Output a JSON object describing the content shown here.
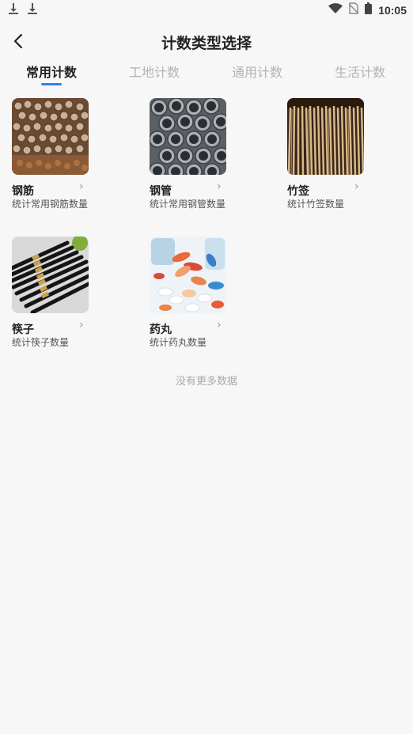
{
  "status_bar": {
    "time": "10:05",
    "left_icons": [
      "download-icon",
      "download-icon"
    ],
    "right_icons": [
      "wifi-icon",
      "no-sim-icon",
      "battery-icon"
    ]
  },
  "header": {
    "title": "计数类型选择",
    "back_icon": "chevron-left-icon"
  },
  "tabs": [
    {
      "label": "常用计数",
      "active": true
    },
    {
      "label": "工地计数",
      "active": false
    },
    {
      "label": "通用计数",
      "active": false
    },
    {
      "label": "生活计数",
      "active": false
    }
  ],
  "colors": {
    "accent": "#2f80ed"
  },
  "cards": [
    {
      "title": "钢筋",
      "desc": "统计常用钢筋数量",
      "image": "rebar-bundle"
    },
    {
      "title": "钢管",
      "desc": "统计常用钢管数量",
      "image": "steel-pipes"
    },
    {
      "title": "竹签",
      "desc": "统计竹签数量",
      "image": "bamboo-skewers"
    },
    {
      "title": "筷子",
      "desc": "统计筷子数量",
      "image": "chopsticks"
    },
    {
      "title": "药丸",
      "desc": "统计药丸数量",
      "image": "pills"
    }
  ],
  "footer": {
    "no_more": "没有更多数据"
  }
}
